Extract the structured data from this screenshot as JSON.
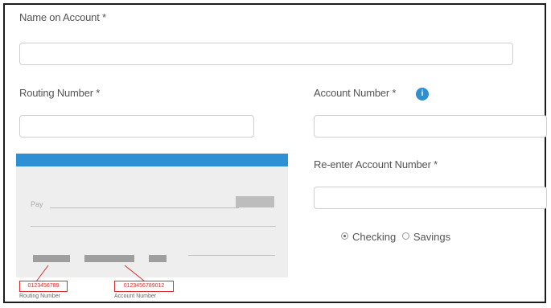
{
  "form": {
    "name_label": "Name on Account *",
    "name_value": "",
    "routing_label": "Routing Number *",
    "routing_value": "",
    "account_label": "Account Number *",
    "account_value": "",
    "account_info_icon": "info-icon",
    "reenter_label": "Re-enter Account Number *",
    "reenter_value": "",
    "account_type": {
      "options": [
        "Checking",
        "Savings"
      ],
      "selected": "Checking"
    }
  },
  "check_image": {
    "pay_text": "Pay",
    "routing_number_sample": "0123456789",
    "account_number_sample": "0123456789012",
    "routing_caption": "Routing Number",
    "account_caption": "Account Number",
    "header_color": "#2d8fd4",
    "highlight_color": "#d62e2e"
  },
  "colors": {
    "info_icon": "#2f8fcf",
    "input_border": "#cfcfcf"
  }
}
